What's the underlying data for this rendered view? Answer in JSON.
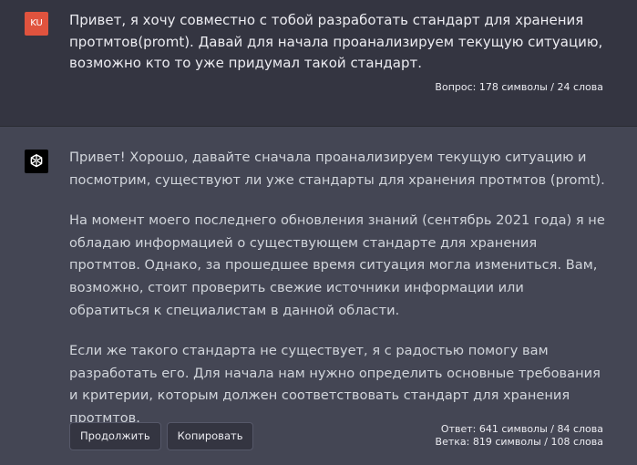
{
  "user": {
    "avatar_initials": "KU",
    "message": "Привет, я хочу совместно с тобой разработать стандарт для хранения протмтов(promt). Давай для начала проанализируем текущую ситуацию, возможно кто то уже придумал такой стандарт.",
    "stats": "Вопрос: 178 символы / 24 слова",
    "avatar_color": "#e0533e"
  },
  "assistant": {
    "avatar_icon": "openai-logo-icon",
    "paragraphs": [
      "Привет! Хорошо, давайте сначала проанализируем текущую ситуацию и посмотрим, существуют ли уже стандарты для хранения протмтов (promt).",
      "На момент моего последнего обновления знаний (сентябрь 2021 года) я не обладаю информацией о существующем стандарте для хранения протмтов. Однако, за прошедшее время ситуация могла измениться. Вам, возможно, стоит проверить свежие источники информации или обратиться к специалистам в данной области.",
      "Если же такого стандарта не существует, я с радостью помогу вам разработать его. Для начала нам нужно определить основные требования и критерии, которым должен соответствовать стандарт для хранения протмтов."
    ],
    "buttons": {
      "continue_label": "Продолжить",
      "copy_label": "Копировать"
    },
    "stats": {
      "answer": "Ответ: 641 символы / 84 слова",
      "branch": "Ветка: 819 символы / 108 слова"
    }
  },
  "colors": {
    "user_bg": "#343541",
    "assistant_bg": "#444654",
    "text": "#ececf1"
  }
}
